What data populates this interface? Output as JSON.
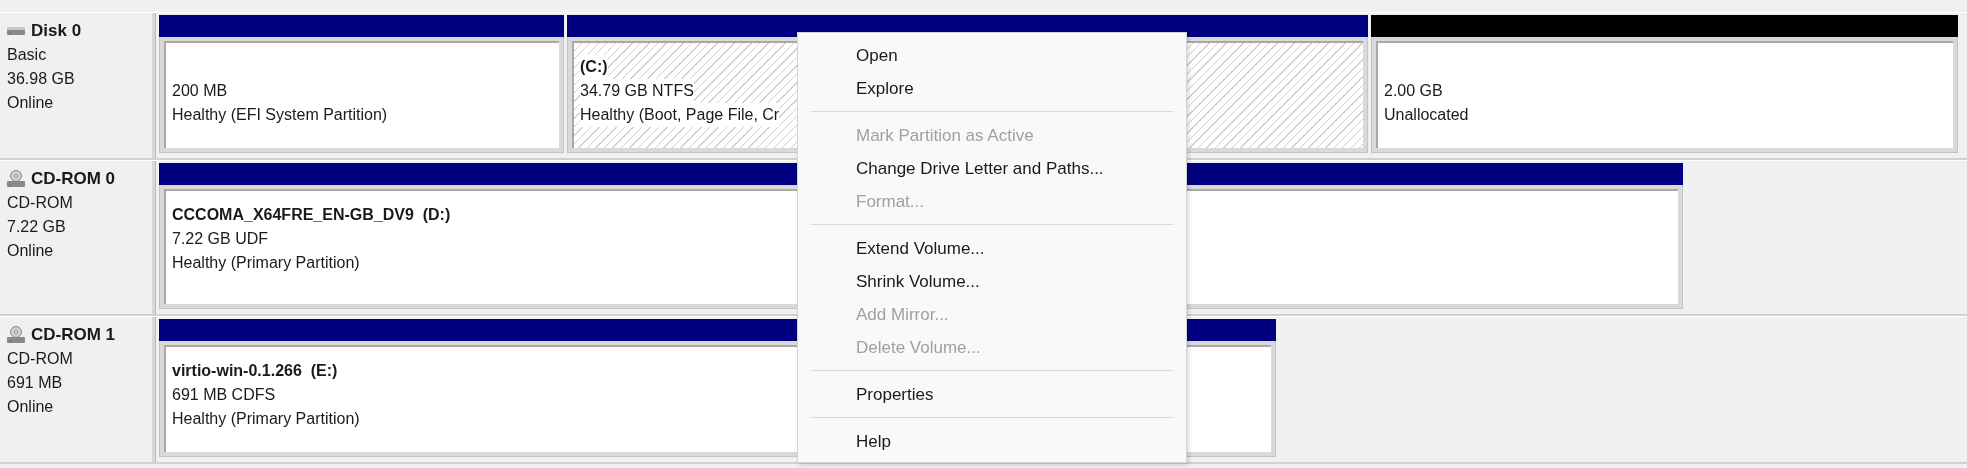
{
  "disks": [
    {
      "kind": "hdd",
      "name": "Disk 0",
      "type": "Basic",
      "size": "36.98 GB",
      "status": "Online",
      "partitions": [
        {
          "size": "200 MB",
          "status": "Healthy (EFI System Partition)",
          "color": "#000080",
          "selected": false
        },
        {
          "name": "(C:)",
          "size": "34.79 GB NTFS",
          "status": "Healthy (Boot, Page File, Cr",
          "color": "#000080",
          "selected": true
        },
        {
          "size": "2.00 GB",
          "status": "Unallocated",
          "color": "#000000",
          "selected": false
        }
      ]
    },
    {
      "kind": "cdrom",
      "name": "CD-ROM 0",
      "type": "CD-ROM",
      "size": "7.22 GB",
      "status": "Online",
      "partitions": [
        {
          "name": "CCCOMA_X64FRE_EN-GB_DV9  (D:)",
          "size": "7.22 GB UDF",
          "status": "Healthy (Primary Partition)",
          "color": "#000080",
          "selected": false
        }
      ]
    },
    {
      "kind": "cdrom",
      "name": "CD-ROM 1",
      "type": "CD-ROM",
      "size": "691 MB",
      "status": "Online",
      "partitions": [
        {
          "name": "virtio-win-0.1.266  (E:)",
          "size": "691 MB CDFS",
          "status": "Healthy (Primary Partition)",
          "color": "#000080",
          "selected": false
        }
      ]
    }
  ],
  "context_menu": {
    "groups": [
      [
        {
          "label": "Open",
          "disabled": false
        },
        {
          "label": "Explore",
          "disabled": false
        }
      ],
      [
        {
          "label": "Mark Partition as Active",
          "disabled": true
        },
        {
          "label": "Change Drive Letter and Paths...",
          "disabled": false
        },
        {
          "label": "Format...",
          "disabled": true
        }
      ],
      [
        {
          "label": "Extend Volume...",
          "disabled": false
        },
        {
          "label": "Shrink Volume...",
          "disabled": false
        },
        {
          "label": "Add Mirror...",
          "disabled": true
        },
        {
          "label": "Delete Volume...",
          "disabled": true
        }
      ],
      [
        {
          "label": "Properties",
          "disabled": false
        }
      ],
      [
        {
          "label": "Help",
          "disabled": false
        }
      ]
    ]
  }
}
